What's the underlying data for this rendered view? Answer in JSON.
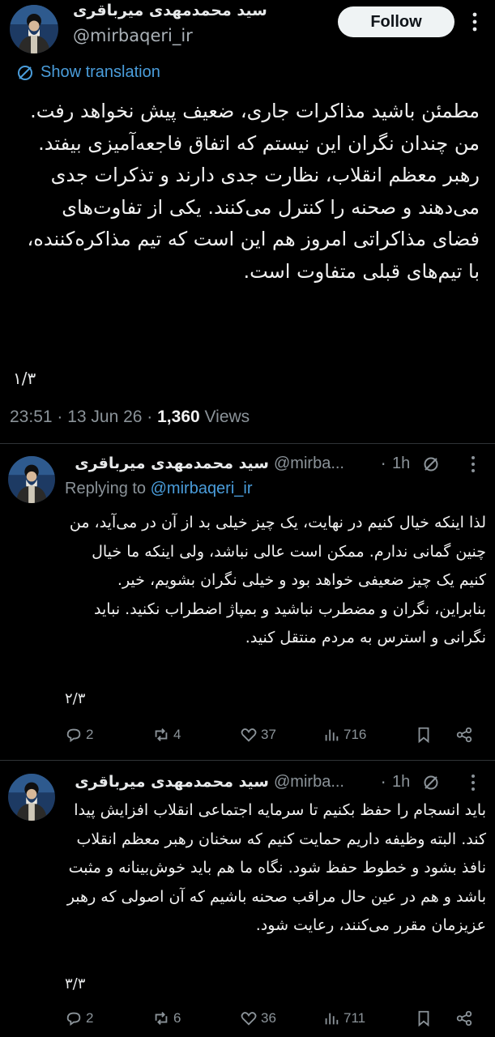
{
  "tweet": {
    "author_name": "سید محمدمهدی میرباقری",
    "handle": "@mirbaqeri_ir",
    "follow_label": "Follow",
    "translate_label": "Show translation",
    "text": "مطمئن باشید مذاکرات جاری، ضعیف پیش نخواهد رفت. من چندان نگران این نیستم که اتفاق فاجعه‌آمیزی بیفتد. رهبر معظم انقلاب، نظارت جدی دارند و تذکرات جدی می‌دهند و صحنه را کنترل می‌کنند. یکی از تفاوت‌های فضای مذاکراتی امروز هم این است که تیم مذاکره‌کننده، با تیم‌های قبلی متفاوت است.",
    "page": "۱/۳",
    "time": "23:51 · 13 Jun 26 · ",
    "views_count": "1,360",
    "views_label": " Views"
  },
  "replies": [
    {
      "author_name": "سید محمدمهدی میرباقری",
      "handle": "@mirba...",
      "time": "1h",
      "replying_prefix": "Replying to ",
      "replying_handle": "@mirbaqeri_ir",
      "text": "لذا اینکه خیال کنیم در نهایت، یک چیز خیلی بد از آن در می‌آید، من چنین گمانی ندارم. ممکن است عالی نباشد، ولی اینکه ما خیال کنیم یک چیز ضعیفی خواهد بود و خیلی نگران بشویم، خیر. بنابراین، نگران و مضطرب نباشید و بمپاژ اضطراب نکنید. نباید نگرانی و استرس به مردم منتقل کنید.",
      "page": "۲/۳",
      "replies_count": "2",
      "retweets_count": "4",
      "likes_count": "37",
      "views_count": "716"
    },
    {
      "author_name": "سید محمدمهدی میرباقری",
      "handle": "@mirba...",
      "time": "1h",
      "text": "باید انسجام را حفظ بکنیم تا سرمایه اجتماعی انقلاب افزایش پیدا کند. البته وظیفه داریم حمایت کنیم که سخنان رهبر معظم انقلاب نافذ بشود و خطوط حفظ شود. نگاه ما هم باید خوش‌بینانه و مثبت باشد و هم در عین حال مراقب صحنه باشیم که آن اصولی که رهبر عزیزمان مقرر می‌کنند، رعایت شود.",
      "page": "۳/۳",
      "replies_count": "2",
      "retweets_count": "6",
      "likes_count": "36",
      "views_count": "711"
    }
  ],
  "colors": {
    "background": "#000000",
    "link": "#4a9ddb",
    "muted": "#8b9399",
    "text": "#f1f1f1"
  },
  "icons": {
    "avatar": "avatar-portrait",
    "translate": "translate-icon",
    "reply": "reply-icon",
    "retweet": "retweet-icon",
    "like": "like-icon",
    "views": "views-icon",
    "bookmark": "bookmark-icon",
    "share": "share-icon",
    "more": "more-icon"
  }
}
